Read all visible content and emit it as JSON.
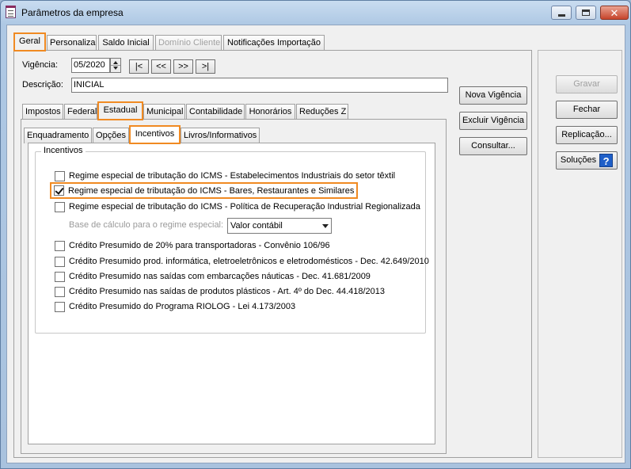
{
  "window": {
    "title": "Parâmetros da empresa"
  },
  "top_tabs": [
    {
      "label": "Geral"
    },
    {
      "label": "Personaliza"
    },
    {
      "label": "Saldo Inicial"
    },
    {
      "label": "Domínio Cliente"
    },
    {
      "label": "Notificações Importação"
    }
  ],
  "header": {
    "vigencia_label": "Vigência:",
    "vigencia_value": "05/2020",
    "nav": [
      "|<",
      "<<",
      ">>",
      ">|"
    ],
    "descricao_label": "Descrição:",
    "descricao_value": "INICIAL"
  },
  "mid_buttons": [
    "Nova Vigência",
    "Excluir Vigência",
    "Consultar..."
  ],
  "side_buttons": {
    "gravar": "Gravar",
    "fechar": "Fechar",
    "replicacao": "Replicação...",
    "solucoes": "Soluções",
    "help": "?"
  },
  "level2_tabs": [
    {
      "label": "Impostos"
    },
    {
      "label": "Federal"
    },
    {
      "label": "Estadual"
    },
    {
      "label": "Municipal"
    },
    {
      "label": "Contabilidade"
    },
    {
      "label": "Honorários"
    },
    {
      "label": "Reduções Z"
    }
  ],
  "level3_tabs": [
    {
      "label": "Enquadramento"
    },
    {
      "label": "Opções"
    },
    {
      "label": "Incentivos"
    },
    {
      "label": "Livros/Informativos"
    }
  ],
  "incentivos": {
    "group_title": "Incentivos",
    "items": [
      {
        "label": "Regime especial de tributação do ICMS - Estabelecimentos Industriais do setor têxtil",
        "checked": false
      },
      {
        "label": "Regime especial de tributação do ICMS - Bares, Restaurantes e Similares",
        "checked": true
      },
      {
        "label": "Regime especial de tributação do ICMS - Política de Recuperação Industrial Regionalizada",
        "checked": false
      }
    ],
    "base_label": "Base de cálculo para o regime especial:",
    "base_value": "Valor contábil",
    "creditos": [
      {
        "label": "Crédito Presumido de 20% para transportadoras - Convênio 106/96",
        "checked": false
      },
      {
        "label": "Crédito Presumido prod. informática, eletroeletrônicos e eletrodomésticos - Dec. 42.649/2010",
        "checked": false
      },
      {
        "label": "Crédito Presumido nas saídas com embarcações náuticas - Dec. 41.681/2009",
        "checked": false
      },
      {
        "label": "Crédito Presumido nas saídas de produtos plásticos - Art. 4º do Dec. 44.418/2013",
        "checked": false
      },
      {
        "label": "Crédito Presumido do Programa RIOLOG - Lei 4.173/2003",
        "checked": false
      }
    ]
  }
}
